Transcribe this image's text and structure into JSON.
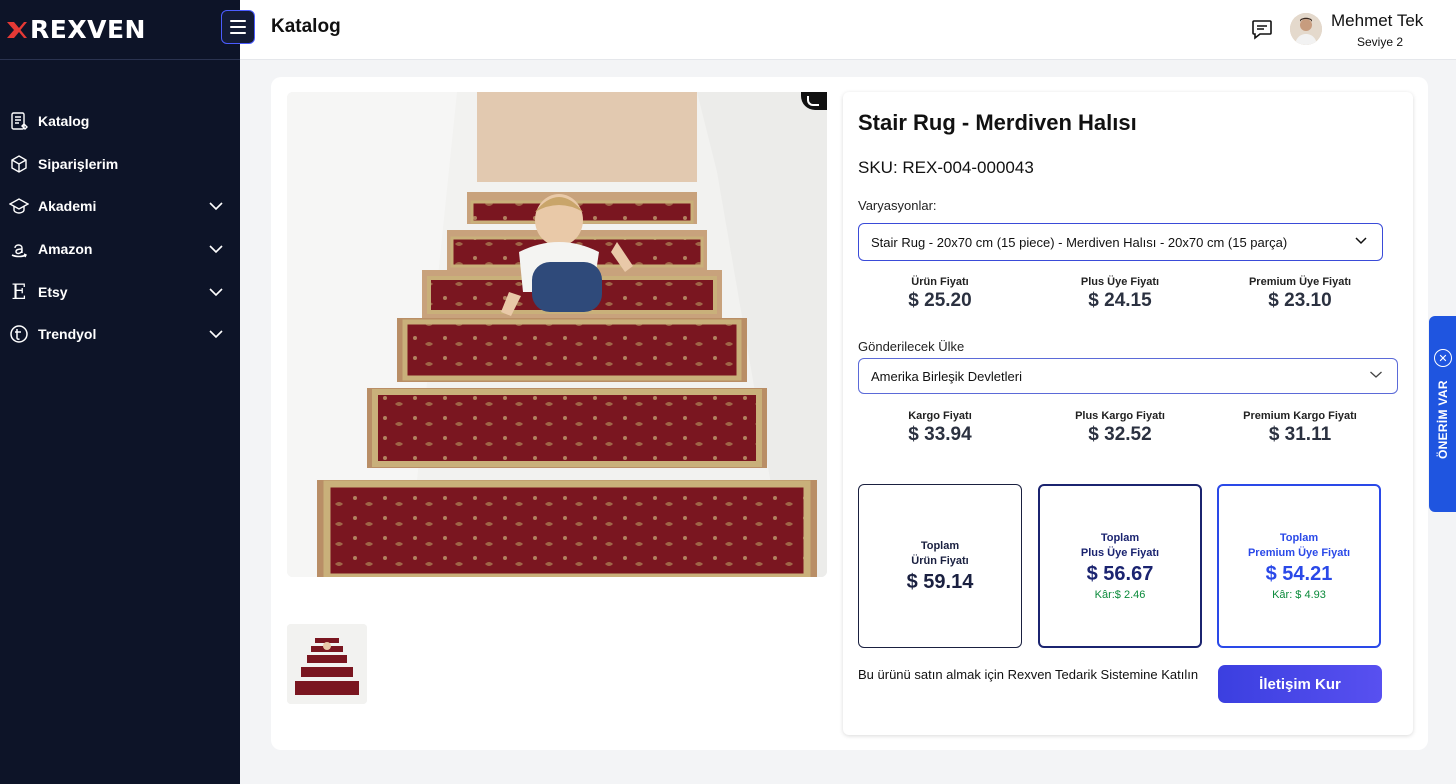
{
  "brand": {
    "name": "REXVEN",
    "accent": "#e53935"
  },
  "sidebar": {
    "items": [
      {
        "label": "Katalog",
        "icon": "catalog-icon",
        "has_chevron": false
      },
      {
        "label": "Siparişlerim",
        "icon": "box-icon",
        "has_chevron": false
      },
      {
        "label": "Akademi",
        "icon": "graduation-cap-icon",
        "has_chevron": true
      },
      {
        "label": "Amazon",
        "icon": "amazon-icon",
        "has_chevron": true
      },
      {
        "label": "Etsy",
        "icon": "etsy-icon",
        "has_chevron": true
      },
      {
        "label": "Trendyol",
        "icon": "trendyol-icon",
        "has_chevron": true
      }
    ]
  },
  "header": {
    "title": "Katalog",
    "user": {
      "name": "Mehmet Tek",
      "level": "Seviye 2"
    }
  },
  "product": {
    "title": "Stair Rug - Merdiven Halısı",
    "sku": "SKU: REX-004-000043",
    "variations_label": "Varyasyonlar:",
    "variation_selected": "Stair Rug - 20x70 cm (15 piece) - Merdiven Halısı - 20x70 cm (15 parça)",
    "prices": [
      {
        "label": "Ürün Fiyatı",
        "value": "$ 25.20"
      },
      {
        "label": "Plus Üye Fiyatı",
        "value": "$ 24.15"
      },
      {
        "label": "Premium Üye Fiyatı",
        "value": "$ 23.10"
      }
    ],
    "country_label": "Gönderilecek Ülke",
    "country_selected": "Amerika Birleşik Devletleri",
    "shipping": [
      {
        "label": "Kargo Fiyatı",
        "value": "$ 33.94"
      },
      {
        "label": "Plus Kargo Fiyatı",
        "value": "$ 32.52"
      },
      {
        "label": "Premium Kargo Fiyatı",
        "value": "$ 31.11"
      }
    ],
    "totals": [
      {
        "line1": "Toplam",
        "line2": "Ürün Fiyatı",
        "value": "$ 59.14",
        "profit": ""
      },
      {
        "line1": "Toplam",
        "line2": "Plus Üye Fiyatı",
        "value": "$ 56.67",
        "profit": "Kâr:$ 2.46"
      },
      {
        "line1": "Toplam",
        "line2": "Premium Üye Fiyatı",
        "value": "$ 54.21",
        "profit": "Kâr: $ 4.93"
      }
    ],
    "join_text": "Bu ürünü satın almak için Rexven Tedarik Sistemine Katılın",
    "contact_button": "İletişim Kur"
  },
  "feedback": {
    "label": "ÖNERİM VAR"
  },
  "colors": {
    "sidebar_bg": "#0d1428",
    "primary": "#2a49e8",
    "profit_green": "#0a8a3a",
    "rug_red": "#7a1620"
  }
}
